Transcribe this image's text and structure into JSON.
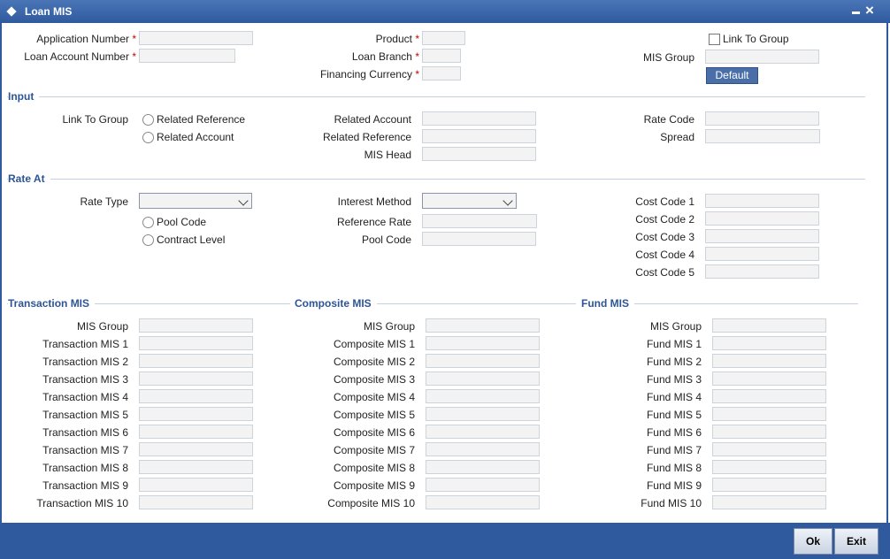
{
  "window": {
    "title": "Loan MIS"
  },
  "header": {
    "application_number": "Application Number",
    "loan_account_number": "Loan Account Number",
    "product": "Product",
    "loan_branch": "Loan Branch",
    "financing_currency": "Financing Currency",
    "link_to_group": "Link To Group",
    "mis_group": "MIS Group",
    "default_button": "Default",
    "required_marker": "*"
  },
  "input": {
    "section_title": "Input",
    "link_to_group": "Link To Group",
    "radio_related_reference": "Related Reference",
    "radio_related_account": "Related Account",
    "related_account": "Related Account",
    "related_reference": "Related Reference",
    "mis_head": "MIS Head",
    "rate_code": "Rate Code",
    "spread": "Spread"
  },
  "rate_at": {
    "section_title": "Rate At",
    "rate_type": "Rate Type",
    "radio_pool_code": "Pool Code",
    "radio_contract_level": "Contract Level",
    "interest_method": "Interest Method",
    "reference_rate": "Reference Rate",
    "pool_code": "Pool Code",
    "cost_codes": [
      "Cost Code 1",
      "Cost Code 2",
      "Cost Code 3",
      "Cost Code 4",
      "Cost Code 5"
    ]
  },
  "transaction_mis": {
    "section_title": "Transaction MIS",
    "labels": [
      "MIS Group",
      "Transaction MIS 1",
      "Transaction MIS 2",
      "Transaction MIS 3",
      "Transaction MIS 4",
      "Transaction MIS 5",
      "Transaction MIS 6",
      "Transaction MIS 7",
      "Transaction MIS 8",
      "Transaction MIS 9",
      "Transaction MIS 10"
    ]
  },
  "composite_mis": {
    "section_title": "Composite MIS",
    "labels": [
      "MIS Group",
      "Composite MIS 1",
      "Composite MIS 2",
      "Composite MIS 3",
      "Composite MIS 4",
      "Composite MIS 5",
      "Composite MIS 6",
      "Composite MIS 7",
      "Composite MIS 8",
      "Composite MIS 9",
      "Composite MIS 10"
    ]
  },
  "fund_mis": {
    "section_title": "Fund MIS",
    "labels": [
      "MIS Group",
      "Fund MIS 1",
      "Fund MIS 2",
      "Fund MIS 3",
      "Fund MIS 4",
      "Fund MIS 5",
      "Fund MIS 6",
      "Fund MIS 7",
      "Fund MIS 8",
      "Fund MIS 9",
      "Fund MIS 10"
    ]
  },
  "footer": {
    "ok_label": "Ok",
    "exit_label": "Exit"
  },
  "colors": {
    "titlebar": "#2f5a9e",
    "section_title": "#2d5596",
    "required": "#cc0000"
  }
}
